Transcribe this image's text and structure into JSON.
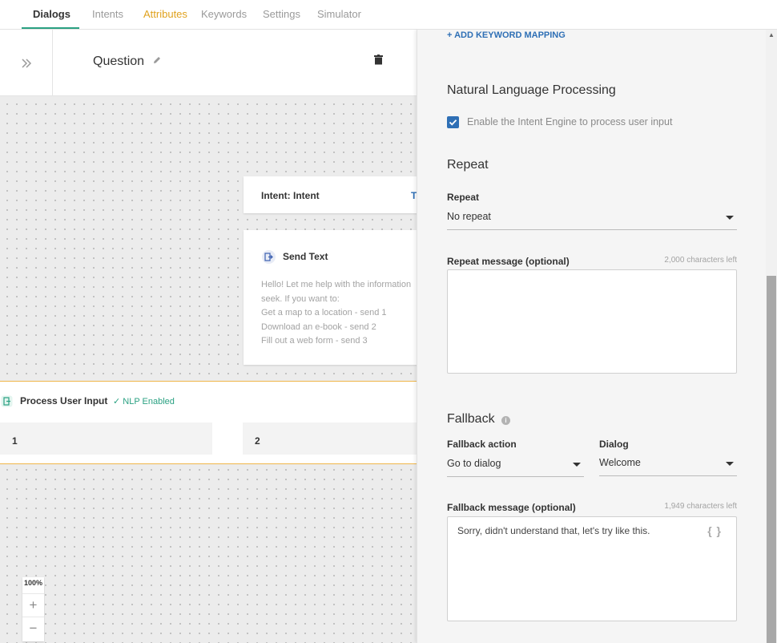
{
  "nav": {
    "tabs": [
      {
        "label": "Dialogs"
      },
      {
        "label": "Intents"
      },
      {
        "label": "Attributes"
      },
      {
        "label": "Keywords"
      },
      {
        "label": "Settings"
      },
      {
        "label": "Simulator"
      }
    ]
  },
  "canvas": {
    "question_title": "Question",
    "intent_card": {
      "title": "Intent: Intent",
      "trigger": "T"
    },
    "send_card": {
      "title": "Send Text",
      "lines": [
        "Hello! Let me help with the information",
        "seek. If you want to:",
        "Get a map to a location - send 1",
        "Download an e-book - send 2",
        "Fill out a web form - send 3"
      ]
    },
    "process": {
      "title": "Process User Input",
      "nlp_badge": "NLP Enabled",
      "options": [
        "1",
        "2"
      ]
    },
    "zoom": {
      "level": "100%",
      "plus": "+",
      "minus": "−"
    }
  },
  "panel": {
    "add_keyword_mapping": "+ ADD KEYWORD MAPPING",
    "nlp": {
      "heading": "Natural Language Processing",
      "checkbox_label": "Enable the Intent Engine to process user input",
      "checked": true
    },
    "repeat": {
      "heading": "Repeat",
      "field_label": "Repeat",
      "selected": "No repeat",
      "message_label": "Repeat message (optional)",
      "chars_left": "2,000 characters left",
      "message_value": ""
    },
    "fallback": {
      "heading": "Fallback",
      "action_label": "Fallback action",
      "action_selected": "Go to dialog",
      "dialog_label": "Dialog",
      "dialog_selected": "Welcome",
      "message_label": "Fallback message (optional)",
      "chars_left": "1,949 characters left",
      "message_value": "Sorry, didn't understand that, let's try like this.",
      "variables_icon": "{ }"
    }
  },
  "colors": {
    "accent": "#2aa182",
    "link": "#2e6fb5",
    "warning": "#e0a21e"
  }
}
